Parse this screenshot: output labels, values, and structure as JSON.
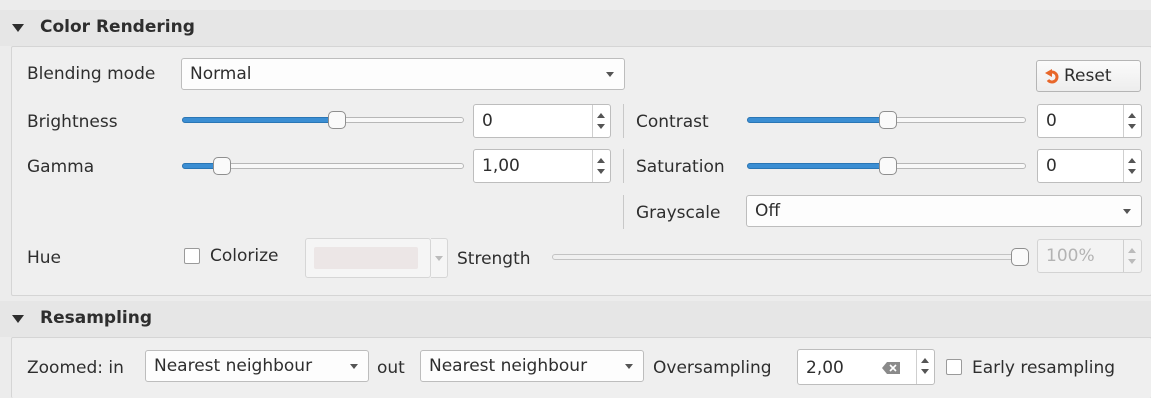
{
  "color_rendering": {
    "title": "Color Rendering",
    "blending_mode_label": "Blending mode",
    "blending_mode_value": "Normal",
    "reset_label": "Reset",
    "brightness_label": "Brightness",
    "brightness_value": "0",
    "brightness_slider_fraction": 0.55,
    "contrast_label": "Contrast",
    "contrast_value": "0",
    "contrast_slider_fraction": 0.5,
    "gamma_label": "Gamma",
    "gamma_value": "1,00",
    "gamma_slider_fraction": 0.12,
    "saturation_label": "Saturation",
    "saturation_value": "0",
    "saturation_slider_fraction": 0.5,
    "grayscale_label": "Grayscale",
    "grayscale_value": "Off",
    "hue_label": "Hue",
    "colorize_label": "Colorize",
    "colorize_checked": false,
    "strength_label": "Strength",
    "strength_value": "100%",
    "strength_slider_fraction": 1.0,
    "colorize_swatch_color": "#ece6e6"
  },
  "resampling": {
    "title": "Resampling",
    "zoomed_in_label": "Zoomed: in",
    "zoomed_in_value": "Nearest neighbour",
    "zoomed_out_label": "out",
    "zoomed_out_value": "Nearest neighbour",
    "oversampling_label": "Oversampling",
    "oversampling_value": "2,00",
    "early_resampling_label": "Early resampling",
    "early_resampling_checked": false
  },
  "colors": {
    "accent": "#3b8ed3",
    "reset_icon": "#e8672a"
  },
  "icons": [
    "collapse-triangle-icon",
    "reset-icon",
    "dropdown-arrow-icon",
    "spin-up-icon",
    "spin-down-icon",
    "clear-icon"
  ]
}
